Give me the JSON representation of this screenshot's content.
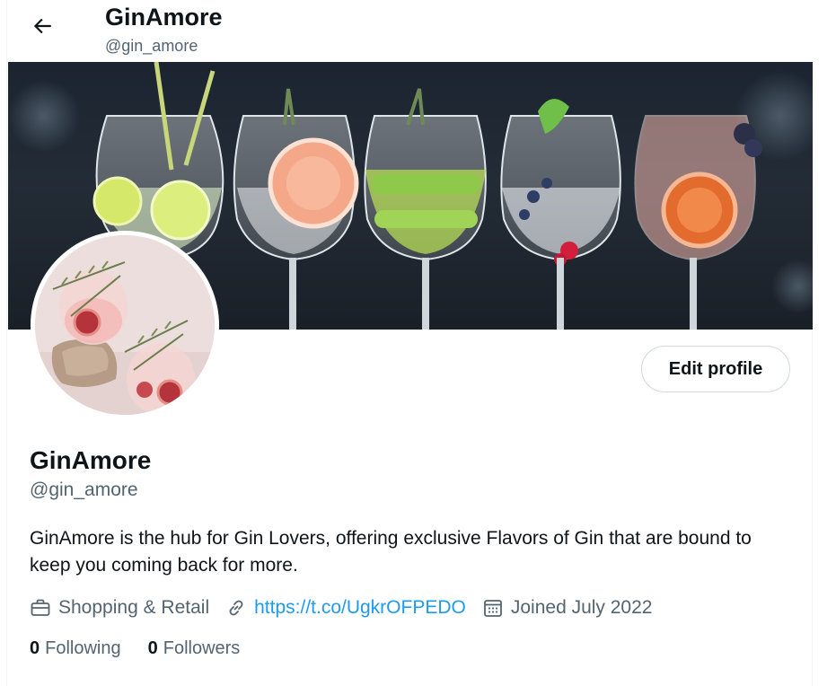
{
  "header": {
    "title": "GinAmore",
    "handle": "@gin_amore"
  },
  "profile": {
    "name": "GinAmore",
    "handle": "@gin_amore",
    "bio": "GinAmore is the hub for Gin Lovers, offering exclusive Flavors of Gin that are bound to keep you coming back for more.",
    "category": "Shopping & Retail",
    "link": "https://t.co/UgkrOFPEDO",
    "joined": "Joined July 2022",
    "following_count": "0",
    "following_label": "Following",
    "followers_count": "0",
    "followers_label": "Followers"
  },
  "actions": {
    "edit_profile_label": "Edit profile"
  },
  "icons": {
    "back": "arrow-left-icon",
    "category": "briefcase-icon",
    "link": "link-icon",
    "joined": "calendar-icon"
  },
  "colors": {
    "accent_link": "#1d9bf0",
    "secondary_text": "#536471",
    "primary_text": "#0f1419",
    "border": "#cfd9de"
  }
}
